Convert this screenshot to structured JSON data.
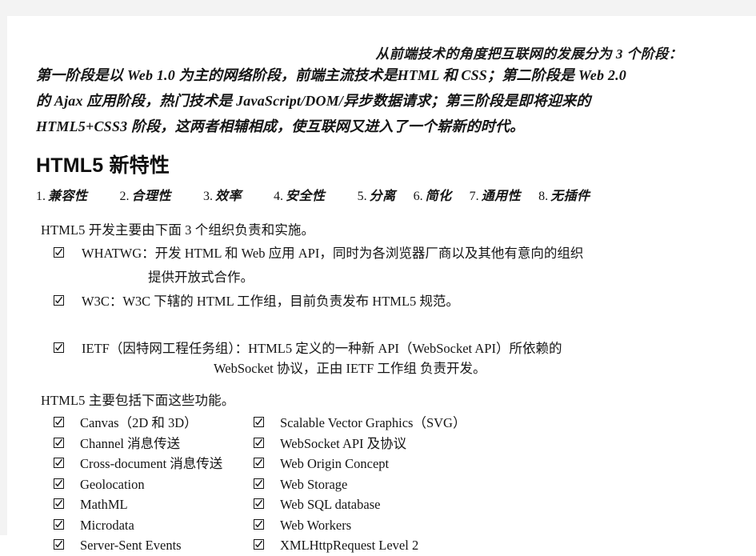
{
  "document": {
    "intro": {
      "lead": "从前端技术的角度把互联网的发展分为 3 个阶段：",
      "lines": [
        "第一阶段是以 Web 1.0 为主的网络阶段，前端主流技术是HTML 和 CSS；第二阶段是 Web 2.0",
        "的 Ajax 应用阶段，热门技术是 JavaScript/DOM/异步数据请求；第三阶段是即将迎来的",
        "HTML5+CSS3 阶段，这两者相辅相成，使互联网又进入了一个崭新的时代。"
      ]
    },
    "heading": "HTML5 新特性",
    "features_numbered": [
      {
        "index": "1.",
        "label": "兼容性"
      },
      {
        "index": "2.",
        "label": "合理性"
      },
      {
        "index": "3.",
        "label": "效率"
      },
      {
        "index": "4.",
        "label": "安全性"
      },
      {
        "index": "5.",
        "label": "分离"
      },
      {
        "index": "6.",
        "label": "简化"
      },
      {
        "index": "7.",
        "label": "通用性"
      },
      {
        "index": "8.",
        "label": "无插件"
      }
    ],
    "orgs_intro": "HTML5 开发主要由下面 3 个组织负责和实施。",
    "orgs": [
      {
        "text": "WHATWG：开发 HTML 和 Web 应用 API，同时为各浏览器厂商以及其他有意向的组织",
        "continuation": "提供开放式合作。"
      },
      {
        "text": "W3C：W3C 下辖的 HTML 工作组，目前负责发布 HTML5 规范。",
        "continuation": ""
      }
    ],
    "ietf": {
      "text": "IETF（因特网工程任务组）：HTML5 定义的一种新 API（WebSocket API）所依赖的",
      "continuation": "WebSocket 协议，正由 IETF 工作组 负责开发。"
    },
    "functions_intro": "HTML5 主要包括下面这些功能。",
    "functions": {
      "left_column": [
        "Canvas（2D 和 3D）",
        "Channel 消息传送",
        "Cross-document 消息传送",
        "Geolocation",
        "MathML",
        "Microdata",
        "Server-Sent Events"
      ],
      "right_column": [
        "Scalable Vector Graphics（SVG）",
        "WebSocket API 及协议",
        "Web Origin Concept",
        "Web Storage",
        "Web SQL database",
        "Web Workers",
        "XMLHttpRequest Level 2"
      ]
    },
    "icons": {
      "checkbox": "checked-checkbox-icon"
    },
    "colors": {
      "page_background": "#ffffff",
      "page_edge": "#f3f3f3",
      "text": "#151515"
    }
  }
}
